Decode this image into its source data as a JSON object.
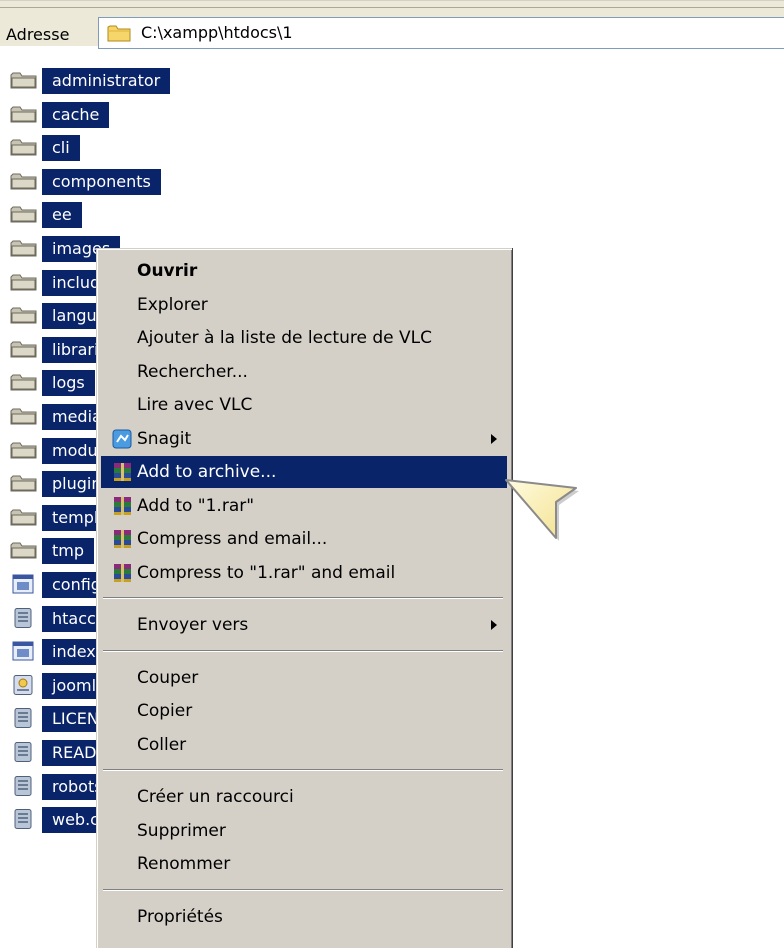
{
  "address_bar": {
    "label": "Adresse",
    "path": "C:\\xampp\\htdocs\\1",
    "icon": "folder-icon"
  },
  "files": [
    {
      "name": "administrator",
      "type": "folder"
    },
    {
      "name": "cache",
      "type": "folder"
    },
    {
      "name": "cli",
      "type": "folder"
    },
    {
      "name": "components",
      "type": "folder"
    },
    {
      "name": "ee",
      "type": "folder"
    },
    {
      "name": "images",
      "type": "folder"
    },
    {
      "name": "includes",
      "type": "folder"
    },
    {
      "name": "language",
      "type": "folder"
    },
    {
      "name": "libraries",
      "type": "folder"
    },
    {
      "name": "logs",
      "type": "folder"
    },
    {
      "name": "media",
      "type": "folder"
    },
    {
      "name": "modules",
      "type": "folder"
    },
    {
      "name": "plugins",
      "type": "folder"
    },
    {
      "name": "templates",
      "type": "folder"
    },
    {
      "name": "tmp",
      "type": "folder"
    },
    {
      "name": "config",
      "type": "php-file"
    },
    {
      "name": "htaccess",
      "type": "text-file"
    },
    {
      "name": "index",
      "type": "php-file"
    },
    {
      "name": "joomla",
      "type": "xml-file"
    },
    {
      "name": "LICENSE",
      "type": "text-file"
    },
    {
      "name": "README",
      "type": "text-file"
    },
    {
      "name": "robots",
      "type": "text-file"
    },
    {
      "name": "web.config",
      "type": "text-file"
    }
  ],
  "context_menu": {
    "items": [
      {
        "label": "Ouvrir",
        "bold": true
      },
      {
        "label": "Explorer"
      },
      {
        "label": "Ajouter à la liste de lecture de VLC"
      },
      {
        "label": "Rechercher..."
      },
      {
        "label": "Lire avec VLC"
      },
      {
        "label": "Snagit",
        "icon": "snagit-icon",
        "submenu": true
      },
      {
        "label": "Add to archive...",
        "icon": "winrar-icon",
        "highlighted": true
      },
      {
        "label": "Add to \"1.rar\"",
        "icon": "winrar-icon"
      },
      {
        "label": "Compress and email...",
        "icon": "winrar-icon"
      },
      {
        "label": "Compress to \"1.rar\" and email",
        "icon": "winrar-icon"
      },
      {
        "separator": true
      },
      {
        "label": "Envoyer vers",
        "submenu": true
      },
      {
        "separator": true
      },
      {
        "label": "Couper"
      },
      {
        "label": "Copier"
      },
      {
        "label": "Coller"
      },
      {
        "separator": true
      },
      {
        "label": "Créer un raccourci"
      },
      {
        "label": "Supprimer"
      },
      {
        "label": "Renommer"
      },
      {
        "separator": true
      },
      {
        "label": "Propriétés"
      }
    ]
  },
  "colors": {
    "selection": "#0a246a",
    "menu_background": "#d4d0c8",
    "pointer_fill": "#fff7c0"
  }
}
